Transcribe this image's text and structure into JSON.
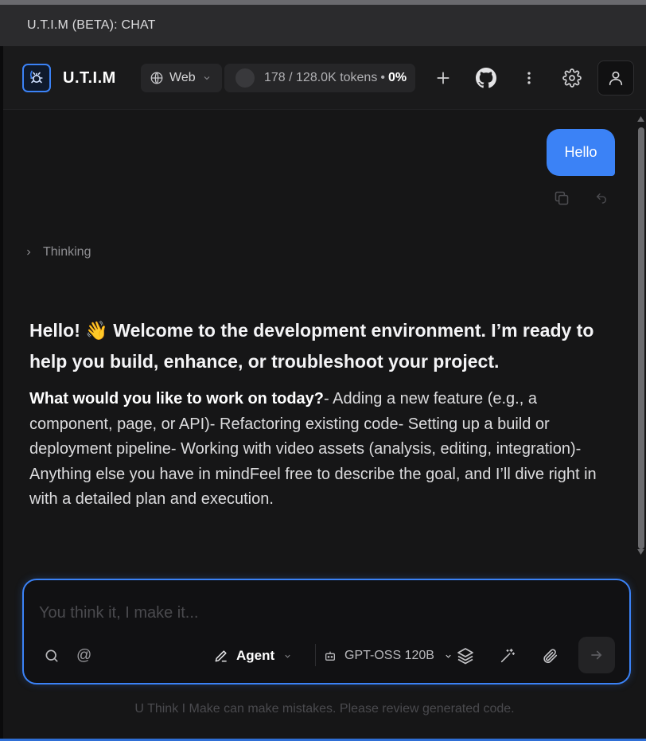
{
  "window": {
    "title": "U.T.I.M (BETA): CHAT"
  },
  "header": {
    "brand": "U.T.I.M",
    "mode": {
      "label": "Web",
      "icon": "globe-icon"
    },
    "tokens": {
      "usage": "178 / 128.0K tokens",
      "separator": "•",
      "percent": "0%"
    },
    "icons": [
      "plus-icon",
      "github-icon",
      "more-vertical-icon",
      "gear-icon",
      "user-icon"
    ]
  },
  "chat": {
    "user_message": "Hello",
    "thinking_label": "Thinking",
    "reply": {
      "heading": "Hello! 👋 Welcome to the development environment. I’m ready to help you build, enhance, or troubleshoot your project.",
      "question": "What would you like to work on today?",
      "body": "- Adding a new feature (e.g., a component, page, or API)- Refactoring existing code- Setting up a build or deployment pipeline- Working with video assets (analysis, editing, integration)- Anything else you have in mindFeel free to describe the goal, and I’ll dive right in with a detailed plan and execution."
    }
  },
  "composer": {
    "placeholder": "You think it, I make it...",
    "at_symbol": "@",
    "agent_label": "Agent",
    "model_label": "GPT-OSS 120B"
  },
  "footer": {
    "disclaimer": "U Think I Make can make mistakes. Please review generated code."
  },
  "colors": {
    "accent": "#3b82f6",
    "background": "#161617",
    "titlebar": "#2b2b2d"
  }
}
